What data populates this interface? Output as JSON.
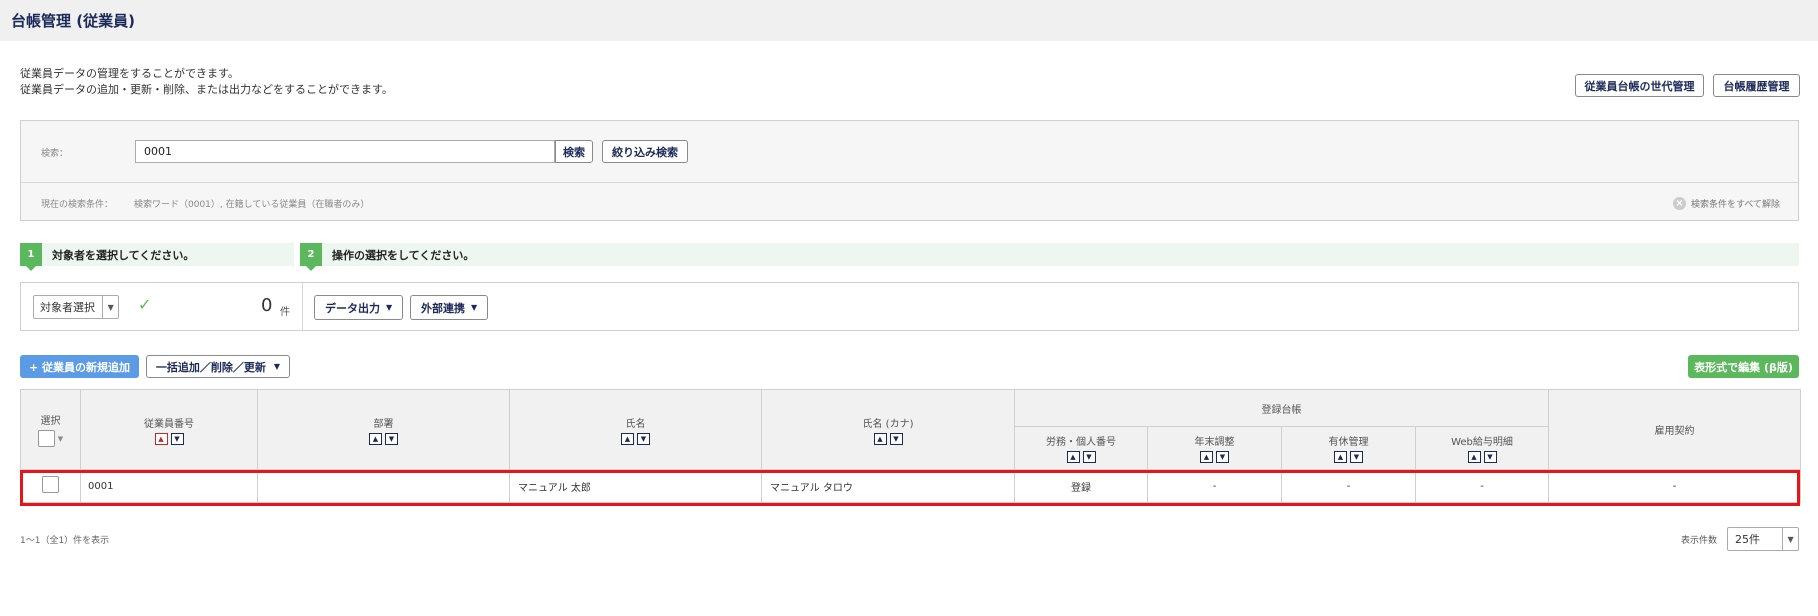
{
  "header": {
    "title": "台帳管理 (従業員)"
  },
  "description": {
    "line1": "従業員データの管理をすることができます。",
    "line2": "従業員データの追加・更新・削除、または出力などをすることができます。"
  },
  "top_buttons": {
    "generation": "従業員台帳の世代管理",
    "history": "台帳履歴管理"
  },
  "search": {
    "label": "検索：",
    "value": "0001",
    "search_button": "検索",
    "filter_button": "絞り込み検索",
    "conditions_label": "現在の検索条件：",
    "conditions_value": "検索ワード（0001）, 在籍している従業員（在職者のみ）",
    "clear_all": "検索条件をすべて解除"
  },
  "steps": [
    {
      "num": "1",
      "text": "対象者を選択してください。"
    },
    {
      "num": "2",
      "text": "操作の選択をしてください。"
    }
  ],
  "operations": {
    "target_select": "対象者選択",
    "count": "0",
    "count_unit": "件",
    "data_output": "データ出力",
    "external_link": "外部連携"
  },
  "actions": {
    "add_employee": "+ 従業員の新規追加",
    "bulk_update": "一括追加／削除／更新",
    "table_edit": "表形式で編集 (β版)"
  },
  "table": {
    "headers": {
      "select": "選択",
      "employee_no": "従業員番号",
      "department": "部署",
      "name": "氏名",
      "name_kana": "氏名 (カナ)",
      "registry_group": "登録台帳",
      "labor": "労務・個人番号",
      "year_end": "年末調整",
      "paid_leave": "有休管理",
      "web_payslip": "Web給与明細",
      "employment_contract": "雇用契約"
    },
    "rows": [
      {
        "employee_no": "0001",
        "department": "",
        "name": "マニュアル 太郎",
        "name_kana": "マニュアル タロウ",
        "labor": "登録",
        "year_end": "-",
        "paid_leave": "-",
        "web_payslip": "-",
        "employment_contract": "-"
      }
    ]
  },
  "footer": {
    "range_text": "1～1（全1）件を表示",
    "per_page_label": "表示件数",
    "per_page_value": "25件"
  },
  "icons": {
    "check": "check-icon",
    "clear": "x-circle-icon",
    "sort_up": "caret-up-icon",
    "sort_down": "caret-down-icon"
  },
  "colors": {
    "title": "#1c2a5a",
    "primary_blue": "#5b9be6",
    "success_green": "#5cb85c",
    "highlight_red": "#e8141c",
    "sort_active": "#c62828"
  }
}
